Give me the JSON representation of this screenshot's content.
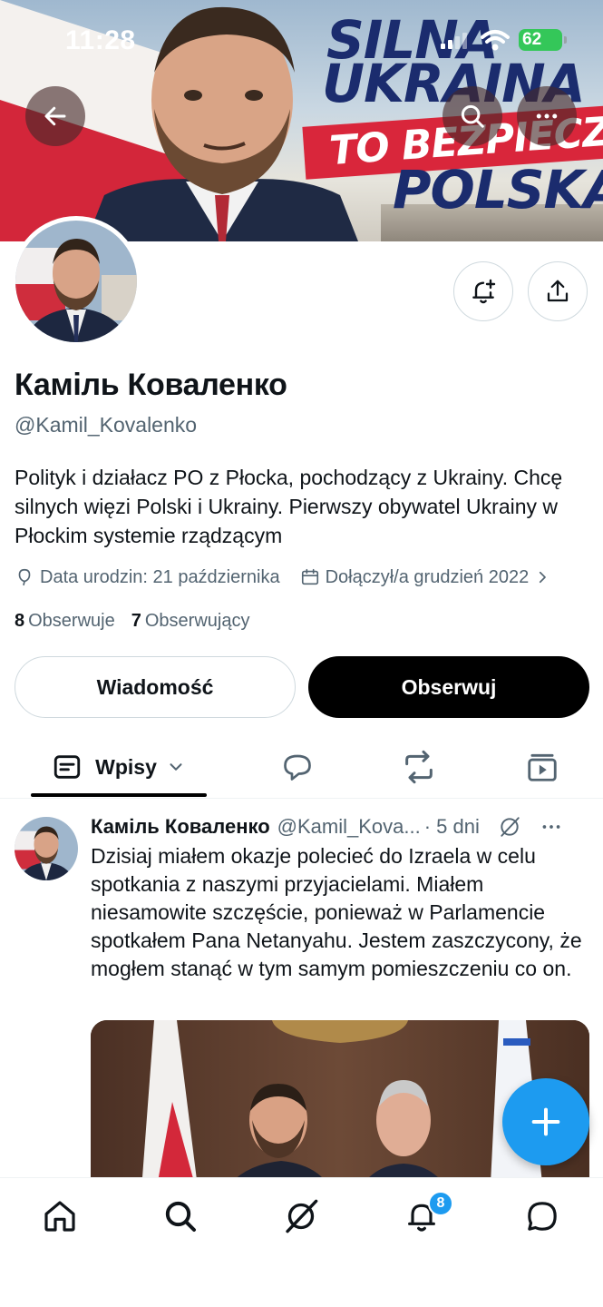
{
  "status_bar": {
    "time": "11:28",
    "battery": "62"
  },
  "banner": {
    "slogan": [
      "SILNA",
      "UKRAINA",
      "TO BEZPIECZNA",
      "POLSKA"
    ]
  },
  "profile": {
    "name": "Каміль Коваленко",
    "handle": "@Kamil_Kovalenko",
    "bio": "Polityk i działacz PO z Płocka, pochodzący z Ukrainy. Chcę silnych więzi Polski i Ukrainy. Pierwszy obywatel Ukrainy w Płockim systemie rządzącym",
    "birthday": "Data urodzin: 21 października",
    "joined": "Dołączył/a grudzień 2022",
    "following_count": "8",
    "following_label": "Obserwuje",
    "followers_count": "7",
    "followers_label": "Obserwujący"
  },
  "actions": {
    "message_label": "Wiadomość",
    "follow_label": "Obserwuj"
  },
  "tabs": {
    "active_label": "Wpisy"
  },
  "tweet": {
    "author": "Каміль Коваленко",
    "handle": "@Kamil_Kova...",
    "time": "· 5 dni",
    "text": "Dzisiaj miałem okazje polecieć do Izraela w celu spotkania z naszymi przyjacielami. Miałem niesamowite szczęście, ponieważ w Parlamencie spotkałem Pana Netanyahu. Jestem zaszczycony, że mogłem stanąć w tym samym pomieszczeniu co on."
  },
  "bottom_nav": {
    "notifications_badge": "8"
  },
  "colors": {
    "accent": "#1d9bf0",
    "text": "#0f1419",
    "secondary": "#536471",
    "border": "#cfd9de"
  }
}
